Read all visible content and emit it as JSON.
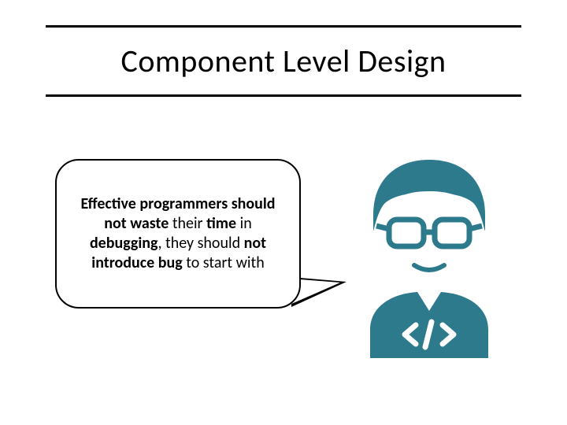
{
  "title": "Component Level Design",
  "bubble": {
    "line1_pre": "Effective programmers should not waste ",
    "line1_mid": "their ",
    "line1_bold2": "time",
    "line2_pre": " in ",
    "line2_bold": "debugging",
    "line2_post": ", they should ",
    "line3_bold": "not introduce bug",
    "line3_post": " to start with"
  },
  "colors": {
    "brand": "#2d7a8c"
  }
}
